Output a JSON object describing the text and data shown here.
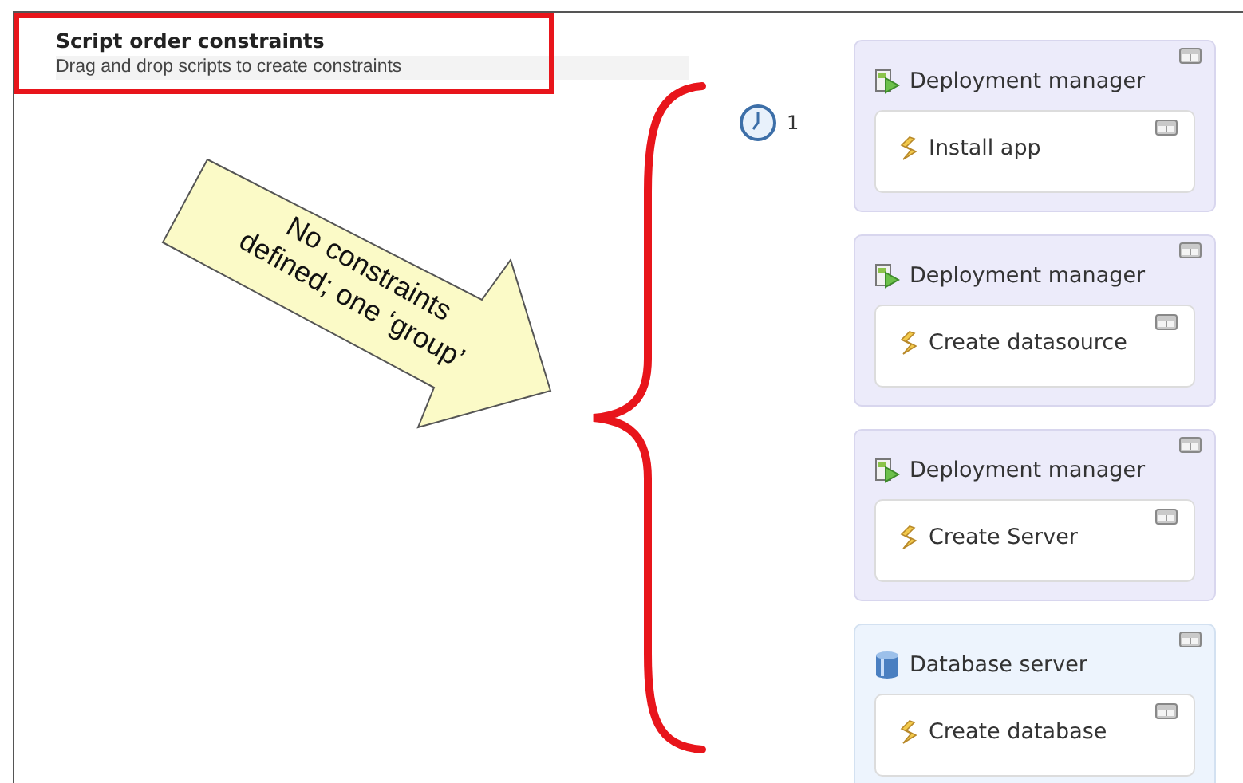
{
  "panel": {
    "title": "Script order constraints",
    "subtitle": "Drag and drop scripts to create constraints"
  },
  "annotation": {
    "text": "No constraints defined; one ‘group’"
  },
  "order_group": {
    "number": "1"
  },
  "groups": [
    {
      "kind": "deployment",
      "name": "Deployment manager",
      "scripts": [
        {
          "name": "Install app"
        }
      ]
    },
    {
      "kind": "deployment",
      "name": "Deployment manager",
      "scripts": [
        {
          "name": "Create datasource"
        }
      ]
    },
    {
      "kind": "deployment",
      "name": "Deployment manager",
      "scripts": [
        {
          "name": "Create Server"
        }
      ]
    },
    {
      "kind": "database",
      "name": "Database server",
      "scripts": [
        {
          "name": "Create database"
        }
      ]
    }
  ]
}
